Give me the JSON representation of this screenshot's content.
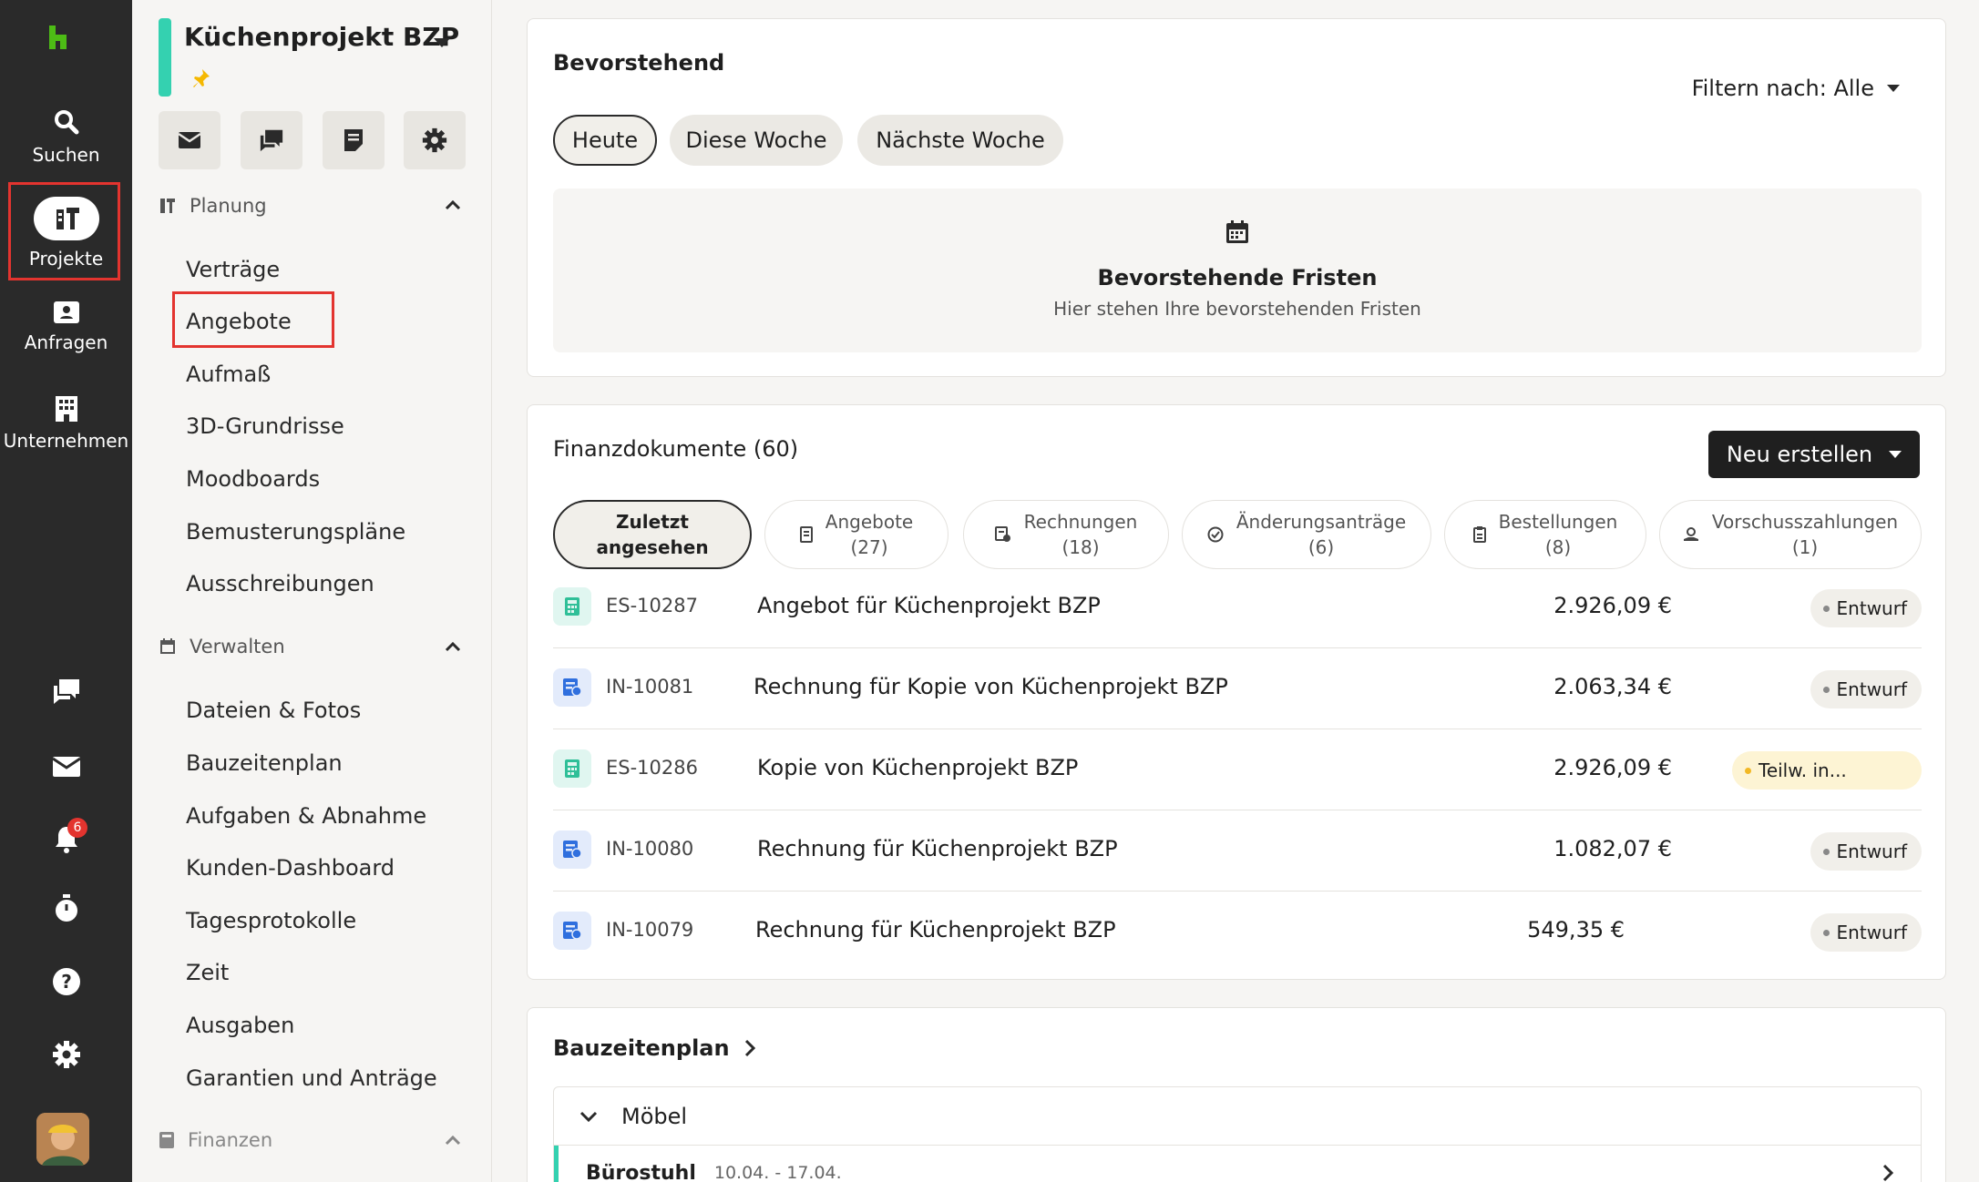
{
  "rail": {
    "items": [
      {
        "label": "Suchen",
        "icon": "search-icon"
      },
      {
        "label": "Projekte",
        "icon": "hammer-icon"
      },
      {
        "label": "Anfragen",
        "icon": "contact-card-icon"
      },
      {
        "label": "Unternehmen",
        "icon": "building-icon"
      }
    ],
    "notification_count": "6",
    "bottom_icons": [
      "chat-icon",
      "mail-icon",
      "bell-icon",
      "timer-icon",
      "help-icon",
      "settings-icon"
    ]
  },
  "sidebar": {
    "project_title": "Küchenprojekt BZP",
    "quick_actions": [
      "mail-icon",
      "chat-icon",
      "notes-icon",
      "settings-icon"
    ],
    "sections": [
      {
        "label": "Planung",
        "items": [
          "Verträge",
          "Angebote",
          "Aufmaß",
          "3D-Grundrisse",
          "Moodboards",
          "Bemusterungspläne",
          "Ausschreibungen"
        ]
      },
      {
        "label": "Verwalten",
        "items": [
          "Dateien & Fotos",
          "Bauzeitenplan",
          "Aufgaben & Abnahme",
          "Kunden-Dashboard",
          "Tagesprotokolle",
          "Zeit",
          "Ausgaben",
          "Garantien und Anträge"
        ]
      },
      {
        "label": "Finanzen",
        "items": []
      }
    ],
    "selected_item": "Angebote"
  },
  "upcoming": {
    "title": "Bevorstehend",
    "filter_label": "Filtern nach: Alle",
    "chips": [
      "Heute",
      "Diese Woche",
      "Nächste Woche"
    ],
    "active_chip": "Heute",
    "empty_title": "Bevorstehende Fristen",
    "empty_subtitle": "Hier stehen Ihre bevorstehenden Fristen"
  },
  "finance": {
    "title": "Finanzdokumente (60)",
    "new_button": "Neu erstellen",
    "tabs": [
      {
        "line1": "Zuletzt",
        "line2": "angesehen",
        "icon": ""
      },
      {
        "line1": "Angebote",
        "line2": "(27)",
        "icon": "estimate-icon"
      },
      {
        "line1": "Rechnungen",
        "line2": "(18)",
        "icon": "invoice-icon"
      },
      {
        "line1": "Änderungsanträge",
        "line2": "(6)",
        "icon": "change-order-icon"
      },
      {
        "line1": "Bestellungen",
        "line2": "(8)",
        "icon": "purchase-order-icon"
      },
      {
        "line1": "Vorschusszahlungen",
        "line2": "(1)",
        "icon": "advance-payment-icon"
      }
    ],
    "rows": [
      {
        "type": "estimate",
        "number": "ES-10287",
        "title": "Angebot für Küchenprojekt BZP",
        "amount": "2.926,09 €",
        "status": "Entwurf"
      },
      {
        "type": "invoice",
        "number": "IN-10081",
        "title": "Rechnung für Kopie von Küchenprojekt BZP",
        "amount": "2.063,34 €",
        "status": "Entwurf"
      },
      {
        "type": "estimate",
        "number": "ES-10286",
        "title": "Kopie von Küchenprojekt BZP",
        "amount": "2.926,09 €",
        "status": "Teilw. in..."
      },
      {
        "type": "invoice",
        "number": "IN-10080",
        "title": "Rechnung für Küchenprojekt BZP",
        "amount": "1.082,07 €",
        "status": "Entwurf"
      },
      {
        "type": "invoice",
        "number": "IN-10079",
        "title": "Rechnung für Küchenprojekt BZP",
        "amount": "549,35 €",
        "status": "Entwurf"
      }
    ]
  },
  "schedule": {
    "title": "Bauzeitenplan",
    "group": "Möbel",
    "task_name": "Bürostuhl",
    "task_dates": "10.04. - 17.04."
  },
  "colors": {
    "accent": "#34d1b0",
    "rail": "#2a2a2a",
    "highlight": "#e3342f",
    "warn": "#f2b824"
  }
}
